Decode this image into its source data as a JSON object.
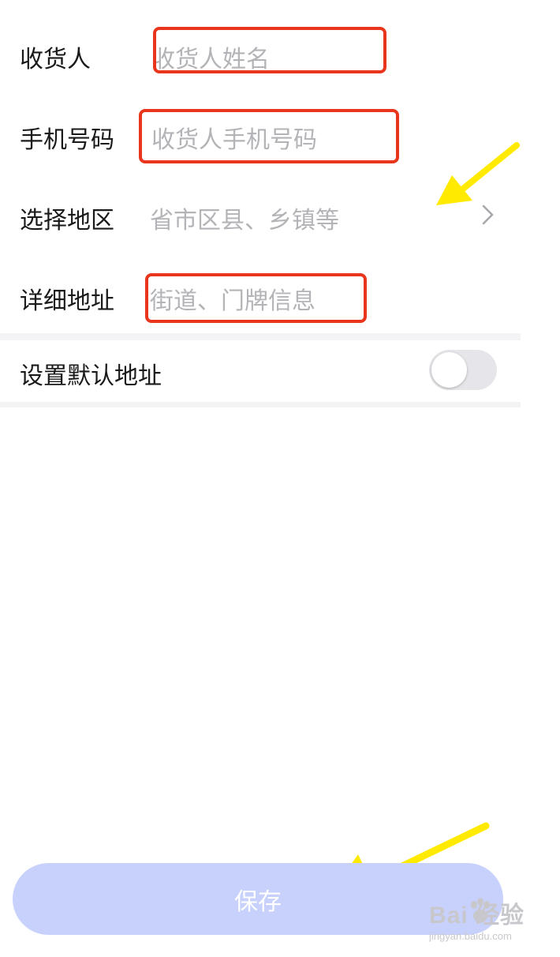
{
  "form": {
    "consignee": {
      "label": "收货人",
      "placeholder": "收货人姓名"
    },
    "phone": {
      "label": "手机号码",
      "placeholder": "收货人手机号码"
    },
    "region": {
      "label": "选择地区",
      "placeholder": "省市区县、乡镇等",
      "icon": "chevron-right-icon"
    },
    "detail": {
      "label": "详细地址",
      "placeholder": "街道、门牌信息"
    },
    "default": {
      "label": "设置默认地址",
      "enabled": false
    }
  },
  "save_label": "保存",
  "watermark": {
    "brand": "Bai  经验",
    "url": "jingyan.baidu.com"
  },
  "colors": {
    "highlight_box": "#e8351c",
    "arrow": "#ffea00",
    "save_button": "#c7d1fb",
    "placeholder": "#b4b4b8"
  }
}
